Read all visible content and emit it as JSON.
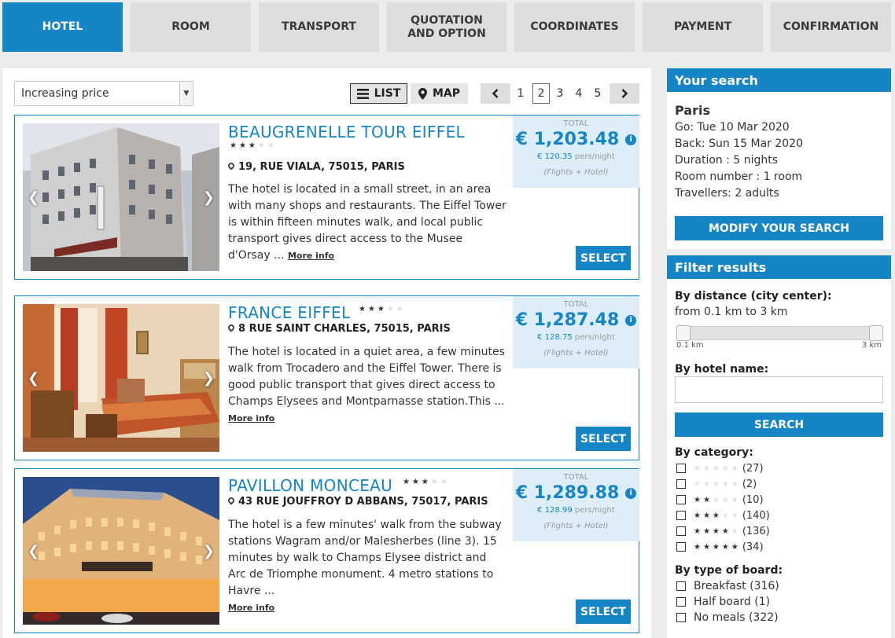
{
  "steps": [
    {
      "label": "HOTEL",
      "active": true
    },
    {
      "label": "ROOM",
      "active": false
    },
    {
      "label": "TRANSPORT",
      "active": false
    },
    {
      "label": "QUOTATION AND OPTION",
      "active": false
    },
    {
      "label": "COORDINATES",
      "active": false
    },
    {
      "label": "PAYMENT",
      "active": false
    },
    {
      "label": "CONFIRMATION",
      "active": false
    }
  ],
  "toolbar": {
    "sort_value": "Increasing price",
    "list_label": "LIST",
    "map_label": "MAP",
    "pages": [
      "1",
      "2",
      "3",
      "4",
      "5"
    ],
    "current_page": "2"
  },
  "hotels": [
    {
      "name": "BEAUGRENELLE TOUR EIFFEL",
      "stars": 3,
      "address": "19, RUE VIALA, 75015, PARIS",
      "description": "The hotel is located in a small street, in an area with many shops and restaurants. The Eiffel Tower is within fifteen minutes walk, and local public transport gives direct access to the Musee d'Orsay ...",
      "more_label": "More info",
      "total_label": "TOTAL",
      "price": "€ 1,203.48",
      "per_night": "€ 120.35",
      "per_night_unit": "pers/night",
      "includes": "(Flights + Hotel)",
      "select_label": "SELECT"
    },
    {
      "name": "FRANCE EIFFEL",
      "stars": 3,
      "address": "8 RUE SAINT CHARLES, 75015, PARIS",
      "description": "The hotel is located in a quiet area, a few minutes walk from Trocadero and the Eiffel Tower. There is good public transport that gives direct access to Champs Elysees and Montparnasse station.This ...",
      "more_label": "More info",
      "total_label": "TOTAL",
      "price": "€ 1,287.48",
      "per_night": "€ 128.75",
      "per_night_unit": "pers/night",
      "includes": "(Flights + Hotel)",
      "select_label": "SELECT"
    },
    {
      "name": "PAVILLON MONCEAU",
      "stars": 3,
      "address": "43 RUE JOUFFROY D ABBANS, 75017, PARIS",
      "description": "The hotel is a few minutes' walk from the subway stations Wagram and/or Malesherbes (line 3). 15 minutes by walk to Champs Elysee district and Arc de Triomphe monument. 4 metro stations to Havre ...",
      "more_label": "More info",
      "total_label": "TOTAL",
      "price": "€ 1,289.88",
      "per_night": "€ 128.99",
      "per_night_unit": "pers/night",
      "includes": "(Flights + Hotel)",
      "select_label": "SELECT"
    }
  ],
  "search": {
    "title": "Your search",
    "city": "Paris",
    "go": "Go: Tue 10 Mar 2020",
    "back": "Back: Sun 15 Mar 2020",
    "duration": "Duration : 5 nights",
    "rooms": "Room number : 1 room",
    "travellers": "Travellers: 2 adults",
    "modify_label": "MODIFY YOUR SEARCH"
  },
  "filters": {
    "title": "Filter results",
    "distance_label": "By distance (city center):",
    "distance_text": "from 0.1 km to 3 km",
    "distance_min": "0.1 km",
    "distance_max": "3 km",
    "name_label": "By hotel name:",
    "name_value": "",
    "search_label": "SEARCH",
    "category_label": "By category:",
    "categories": [
      {
        "stars": 0,
        "count": "(27)"
      },
      {
        "stars": 1,
        "count": "(2)"
      },
      {
        "stars": 2,
        "count": "(10)"
      },
      {
        "stars": 3,
        "count": "(140)"
      },
      {
        "stars": 4,
        "count": "(136)"
      },
      {
        "stars": 5,
        "count": "(34)"
      }
    ],
    "board_label": "By type of board:",
    "boards": [
      {
        "label": "Breakfast",
        "count": "(316)"
      },
      {
        "label": "Half board",
        "count": "(1)"
      },
      {
        "label": "No meals",
        "count": "(322)"
      }
    ]
  }
}
